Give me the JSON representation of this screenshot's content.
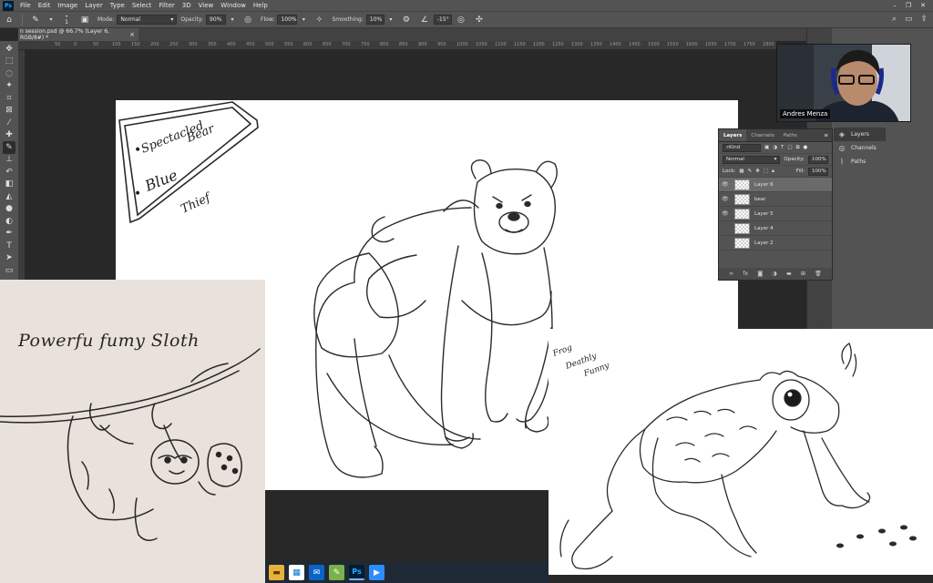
{
  "menubar": {
    "logo": "Ps",
    "items": [
      "File",
      "Edit",
      "Image",
      "Layer",
      "Type",
      "Select",
      "Filter",
      "3D",
      "View",
      "Window",
      "Help"
    ]
  },
  "options_bar": {
    "mode_label": "Mode:",
    "mode_value": "Normal",
    "opacity_label": "Opacity:",
    "opacity_value": "90%",
    "flow_label": "Flow:",
    "flow_value": "100%",
    "smoothing_label": "Smoothing:",
    "smoothing_value": "10%",
    "angle_value": "-15°",
    "brush_size": "1"
  },
  "document_tab": {
    "title": "n session.psd @ 66.7% (Layer 6, RGB/8#) *",
    "close": "×"
  },
  "ruler_top_ticks": [
    "50",
    "0",
    "50",
    "100",
    "150",
    "200",
    "250",
    "300",
    "350",
    "400",
    "450",
    "500",
    "550",
    "600",
    "650",
    "700",
    "750",
    "800",
    "850",
    "900",
    "950",
    "1000",
    "1050",
    "1100",
    "1150",
    "1200",
    "1250",
    "1300",
    "1350",
    "1400",
    "1450",
    "1500",
    "1550",
    "1600",
    "1650",
    "1700",
    "1750",
    "1800",
    "1850"
  ],
  "canvas_notes": {
    "note1_line1": "Spectacled",
    "note1_line2": "Bear",
    "note2_line1": "Blue",
    "note2_line2": "Thief",
    "bullet": "•"
  },
  "frog_notes": {
    "line1": "Frog",
    "line2": "Deathly",
    "line3": "Funny"
  },
  "sloth_photo": {
    "title": "Powerfu fumy Sloth"
  },
  "webcam": {
    "name": "Andres Menza"
  },
  "collapsed_panels": {
    "items": [
      {
        "label": "Layers",
        "icon": "layers-icon"
      },
      {
        "label": "Channels",
        "icon": "channels-icon"
      },
      {
        "label": "Paths",
        "icon": "paths-icon"
      }
    ]
  },
  "layers_panel": {
    "tabs": [
      "Layers",
      "Channels",
      "Paths"
    ],
    "filter_label": "Kind",
    "blend_mode": "Normal",
    "opacity_label": "Opacity:",
    "opacity_value": "100%",
    "lock_label": "Lock:",
    "fill_label": "Fill:",
    "fill_value": "100%",
    "layers": [
      {
        "name": "Layer 6",
        "visible": true,
        "selected": true
      },
      {
        "name": "bear",
        "visible": true,
        "selected": false
      },
      {
        "name": "Layer 5",
        "visible": true,
        "selected": false
      },
      {
        "name": "Layer 4",
        "visible": false,
        "selected": false
      },
      {
        "name": "Layer 2",
        "visible": false,
        "selected": false
      }
    ],
    "footer_icons": [
      "link-icon",
      "fx-icon",
      "mask-icon",
      "adjustment-icon",
      "group-icon",
      "new-layer-icon",
      "trash-icon"
    ],
    "footer_fx": "fx"
  },
  "taskbar": {
    "apps": [
      "file-explorer-icon",
      "store-icon",
      "mail-icon",
      "notes-icon",
      "photoshop-icon",
      "zoom-icon"
    ],
    "ps_label": "Ps"
  },
  "colors": {
    "ps_blue": "#31a8ff",
    "panel_bg": "#535353",
    "canvas_bg": "#282828"
  }
}
